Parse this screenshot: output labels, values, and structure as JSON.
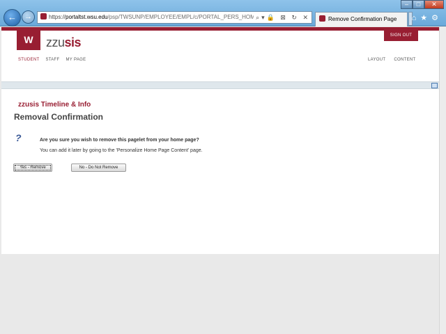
{
  "browser": {
    "url_scheme": "https://",
    "url_host": "portaltst.wsu.edu",
    "url_path": "/psp/TWSUNP/EMPLOYEE/EMPL/c/PORTAL_PERS_HOMEPAGE.P",
    "addr_icons": "⌕▾🔒 ⊠ ↻ ✕",
    "tab_title": "Remove Confirmation Page",
    "back_glyph": "←",
    "forward_glyph": "→",
    "win_min": "–",
    "win_max": "□",
    "win_close": "✕",
    "tool_icons": "⌂★⚙"
  },
  "header": {
    "logo_glyph": "W",
    "brand_plain": "zzu",
    "brand_strong": "sis",
    "signout_label": "SIGN OUT",
    "nav_left": [
      "STUDENT",
      "STAFF",
      "MY PAGE"
    ],
    "nav_right": [
      "LAYOUT",
      "CONTENT"
    ]
  },
  "content": {
    "pagelet_title": "zzusis Timeline & Info",
    "heading": "Removal Confirmation",
    "question_icon": "?",
    "question": "Are you sure you wish to remove this pagelet from your home page?",
    "hint": "You can add it later by going to the 'Personalize Home Page Content' page.",
    "yes_label": "Yes - Remove",
    "no_label": "No - Do Not Remove"
  },
  "colors": {
    "brand": "#981e32",
    "chrome": "#6aa9da"
  }
}
